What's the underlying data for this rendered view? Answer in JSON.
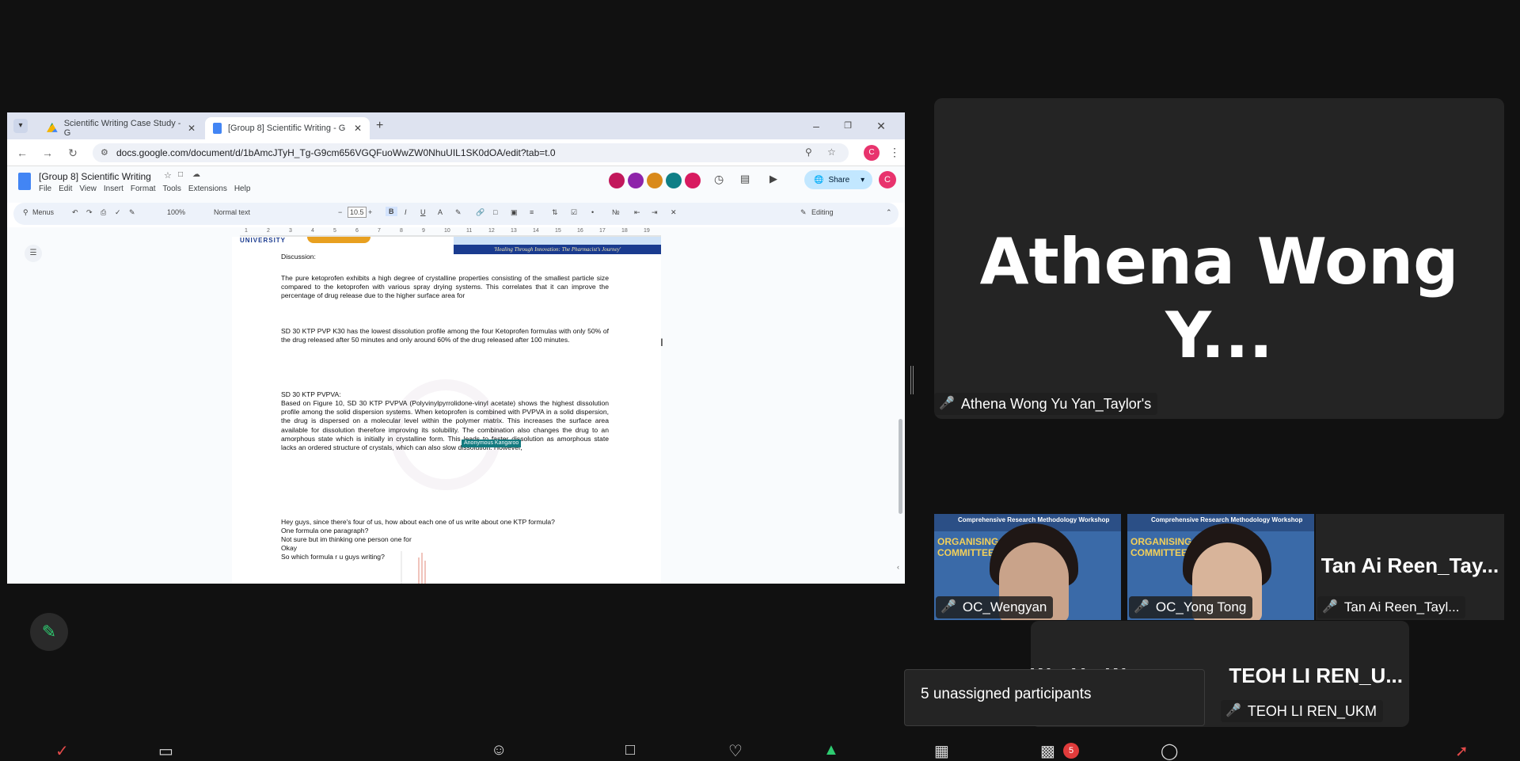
{
  "browser": {
    "tabs": [
      {
        "label": "Scientific Writing Case Study - G"
      },
      {
        "label": "[Group 8] Scientific Writing - G"
      }
    ],
    "url": "docs.google.com/document/d/1bAmcJTyH_Tg-G9cm656VGQFuoWwZW0NhuUIL1SK0dOA/edit?tab=t.0"
  },
  "docs": {
    "title": "[Group 8] Scientific Writing",
    "menu": [
      "File",
      "Edit",
      "View",
      "Insert",
      "Format",
      "Tools",
      "Extensions",
      "Help"
    ],
    "share_label": "Share",
    "avatar_letter": "C",
    "toolbar": {
      "menus_label": "Menus",
      "zoom": "100%",
      "style": "Normal text",
      "font_size": "10.5",
      "mode": "Editing"
    },
    "ruler": [
      "1",
      "2",
      "3",
      "4",
      "5",
      "6",
      "7",
      "8",
      "9",
      "10",
      "11",
      "12",
      "13",
      "14",
      "15",
      "16",
      "17",
      "18",
      "19"
    ],
    "banner_university": "UNIVERSITY",
    "banner_tagline": "'Healing Through Innovation: The Pharmacist's Journey'",
    "collaborator_tag": "Anonymous Kangaroo",
    "paragraphs": {
      "discussion": "Discussion:",
      "p1": "The pure ketoprofen exhibits a high degree of crystalline properties consisting of the smallest particle size compared to the ketoprofen with various spray drying systems. This correlates that it can improve the percentage of drug release due to the higher surface area for",
      "p2": "SD 30 KTP PVP K30 has the lowest dissolution profile among the four Ketoprofen formulas with only 50% of the drug released after 50 minutes and only around 60% of the drug released after 100 minutes.",
      "p3_heading": "SD 30 KTP PVPVA:",
      "p3": "Based on Figure 10, SD 30 KTP PVPVA (Polyvinylpyrrolidone-vinyl acetate) shows the highest dissolution profile among the solid dispersion systems. When ketoprofen is combined with PVPVA in a solid dispersion, the drug is dispersed on a molecular level within the polymer matrix. This increases the surface area available for dissolution therefore improving its solubility. The combination also changes the drug to an amorphous state which is initially in crystalline form. This leads to faster dissolution as amorphous state lacks an ordered structure of crystals, which can also slow dissolution. However,",
      "chat1": "Hey guys, since there's four of us, how about each one of us write about one KTP formula?",
      "chat2": "One formula one paragraph?",
      "chat3": "Not sure but im thinking one person one for",
      "chat4": "Okay",
      "chat5": "So which formula r u guys writing?"
    }
  },
  "meeting": {
    "speaker": {
      "display_name": "Athena Wong Y...",
      "full_name": "Athena Wong Yu Yan_Taylor's"
    },
    "participants": [
      {
        "name": "OC_Wengyan",
        "side_text": "ORGANISING COMMITTEE"
      },
      {
        "name": "OC_Yong Tong",
        "side_text": "ORGANISING COMMITTEE"
      },
      {
        "name": "Tan Ai Reen_Tayl...",
        "display_name": "Tan Ai Reen_Tay..."
      }
    ],
    "video_header": "Comprehensive Research Methodology Workshop",
    "teoh": {
      "display_name": "TEOH LI REN_U...",
      "partial_name": "W... Y... W...",
      "full_name": "TEOH LI REN_UKM"
    },
    "unassigned_text": "5 unassigned participants",
    "badge_count": "5"
  },
  "colors": {
    "background": "#111111",
    "tile": "#242424",
    "muted_mic": "#e24a4a",
    "docs_blue": "#4285f4",
    "share_bg": "#c2e7ff",
    "badge": "#e03b3b"
  }
}
